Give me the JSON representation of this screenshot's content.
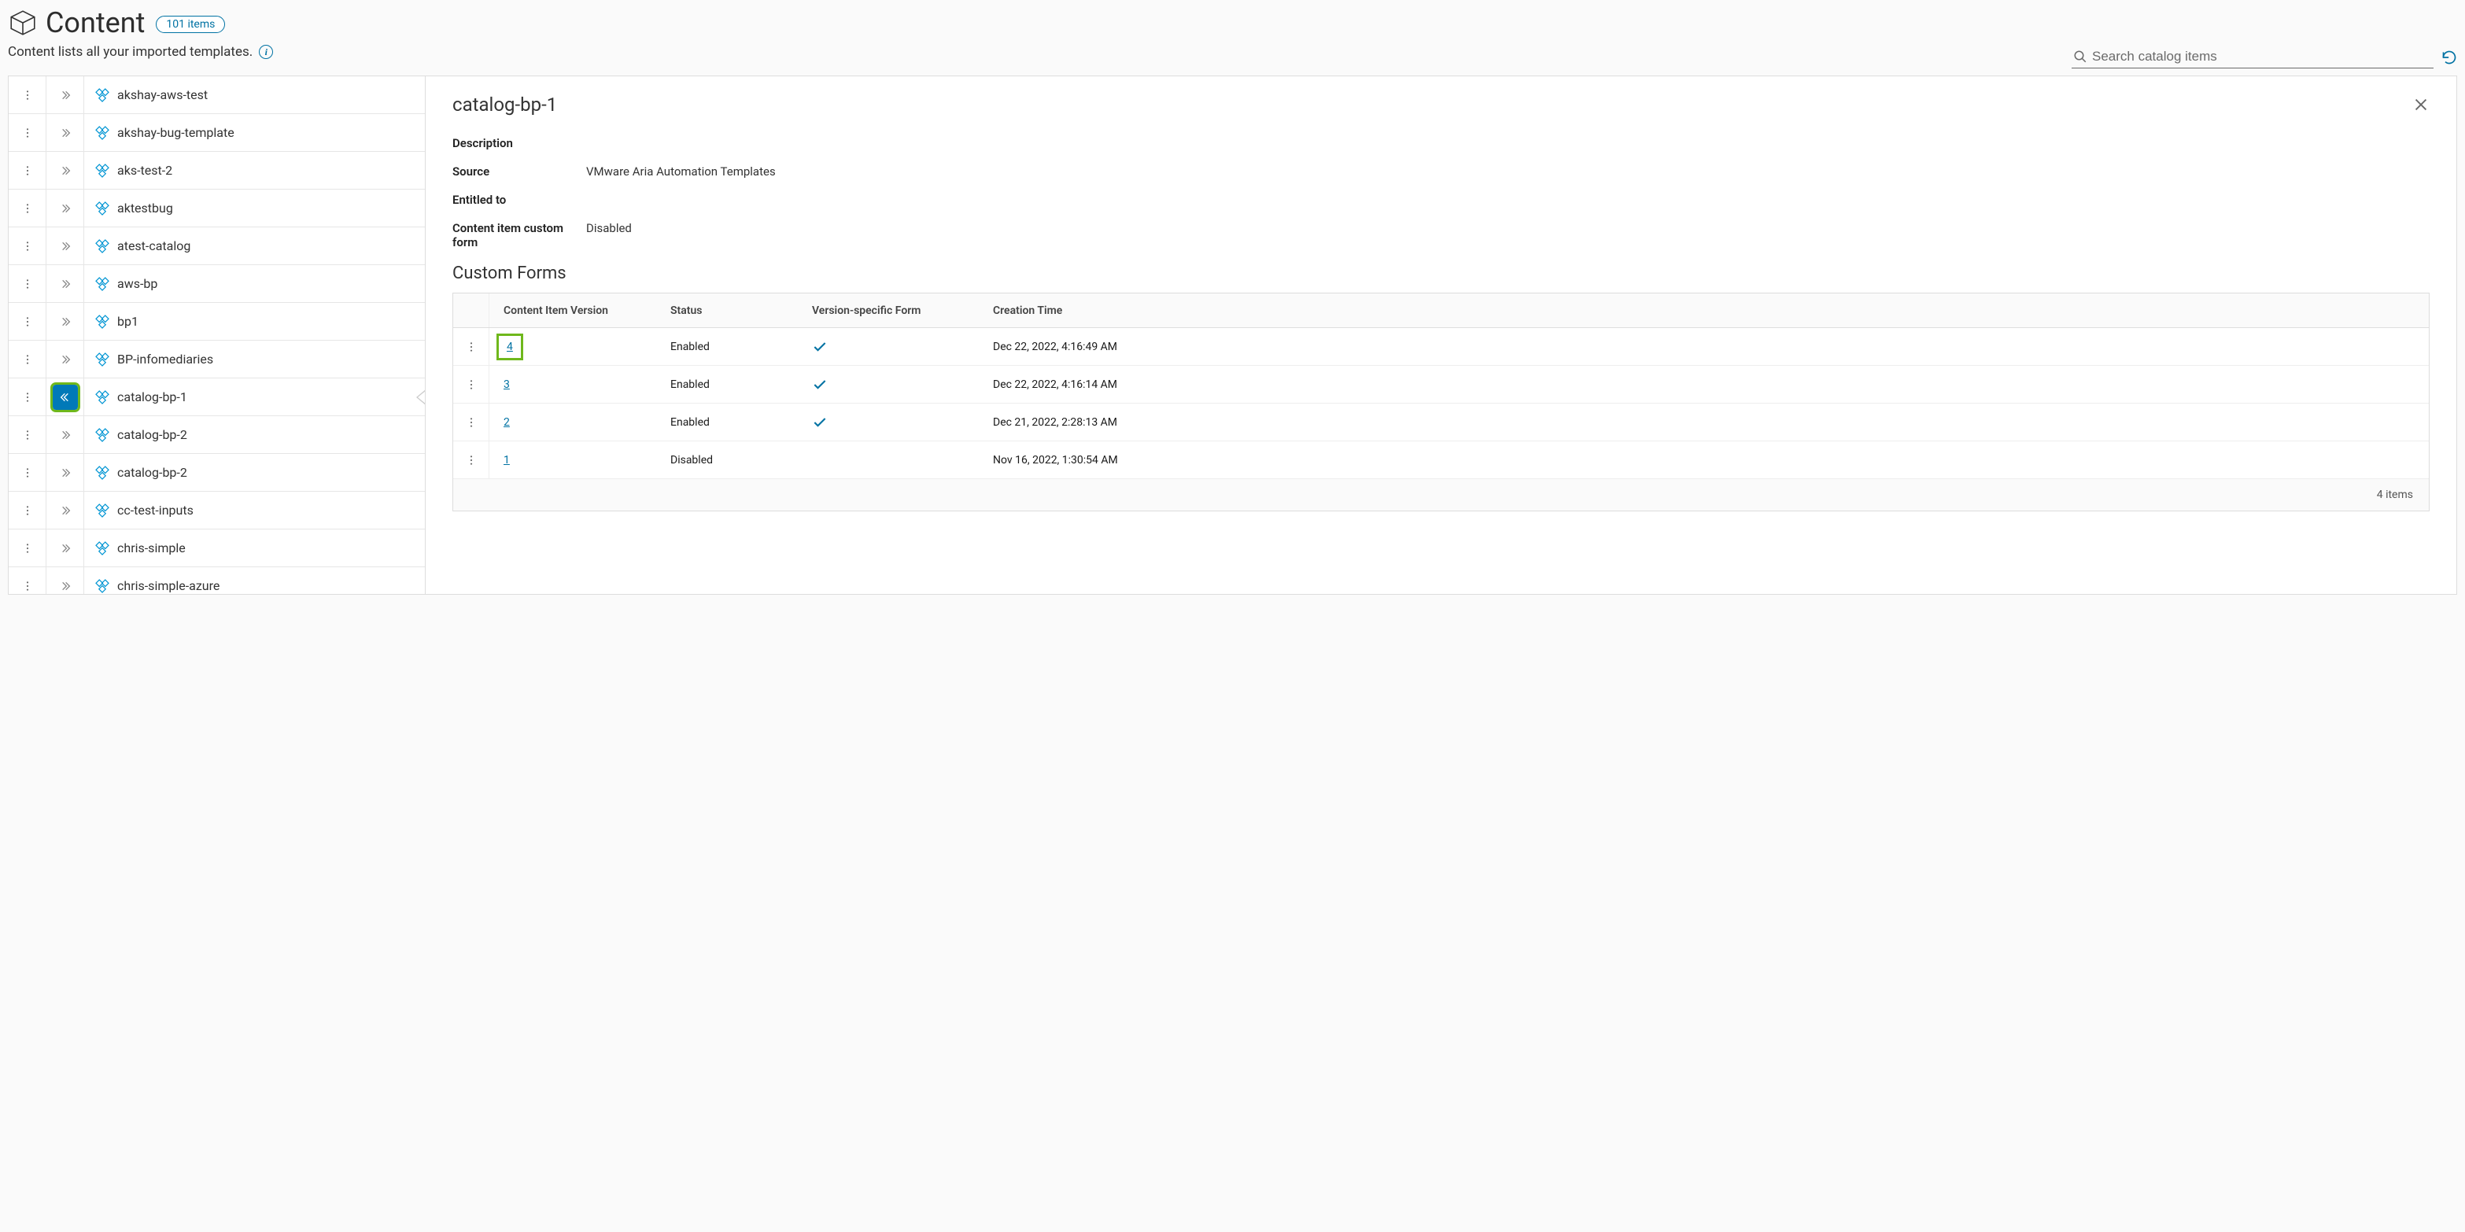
{
  "header": {
    "title": "Content",
    "badge": "101 items",
    "subtitle": "Content lists all your imported templates."
  },
  "search": {
    "placeholder": "Search catalog items"
  },
  "list": {
    "items": [
      {
        "name": "akshay-aws-test",
        "selected": false
      },
      {
        "name": "akshay-bug-template",
        "selected": false
      },
      {
        "name": "aks-test-2",
        "selected": false
      },
      {
        "name": "aktestbug",
        "selected": false
      },
      {
        "name": "atest-catalog",
        "selected": false
      },
      {
        "name": "aws-bp",
        "selected": false
      },
      {
        "name": "bp1",
        "selected": false
      },
      {
        "name": "BP-infomediaries",
        "selected": false
      },
      {
        "name": "catalog-bp-1",
        "selected": true
      },
      {
        "name": "catalog-bp-2",
        "selected": false
      },
      {
        "name": "catalog-bp-2",
        "selected": false
      },
      {
        "name": "cc-test-inputs",
        "selected": false
      },
      {
        "name": "chris-simple",
        "selected": false
      },
      {
        "name": "chris-simple-azure",
        "selected": false
      }
    ]
  },
  "detail": {
    "title": "catalog-bp-1",
    "labels": {
      "description": "Description",
      "source": "Source",
      "entitled": "Entitled to",
      "customform": "Content item custom form"
    },
    "values": {
      "description": "",
      "source": "VMware Aria Automation Templates",
      "entitled": "",
      "customform": "Disabled"
    },
    "custom_forms_heading": "Custom Forms",
    "table": {
      "headers": {
        "version": "Content Item Version",
        "status": "Status",
        "form": "Version-specific Form",
        "time": "Creation Time"
      },
      "rows": [
        {
          "version": "4",
          "status": "Enabled",
          "form": true,
          "time": "Dec 22, 2022, 4:16:49 AM",
          "hl": true
        },
        {
          "version": "3",
          "status": "Enabled",
          "form": true,
          "time": "Dec 22, 2022, 4:16:14 AM",
          "hl": false
        },
        {
          "version": "2",
          "status": "Enabled",
          "form": true,
          "time": "Dec 21, 2022, 2:28:13 AM",
          "hl": false
        },
        {
          "version": "1",
          "status": "Disabled",
          "form": false,
          "time": "Nov 16, 2022, 1:30:54 AM",
          "hl": false
        }
      ],
      "footer": "4 items"
    }
  }
}
